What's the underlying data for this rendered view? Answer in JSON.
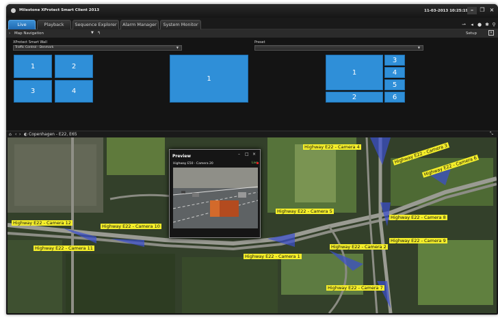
{
  "app": {
    "title": "Milestone XProtect Smart Client 2013",
    "datetime": "11-03-2013 10:25:19"
  },
  "tabs": [
    {
      "label": "Live"
    },
    {
      "label": "Playback"
    },
    {
      "label": "Sequence Explorer"
    },
    {
      "label": "Alarm Manager"
    },
    {
      "label": "System Monitor"
    }
  ],
  "nav": {
    "map_navigation": "Map Navigation",
    "setup": "Setup"
  },
  "smartwall": {
    "label": "XProtect Smart Wall",
    "selected": "Traffic Control - Denmark",
    "preset_label": "Preset",
    "preset_value": ""
  },
  "monitors": {
    "m1": [
      "1",
      "2",
      "3",
      "4"
    ],
    "m2": [
      "1"
    ],
    "m3": [
      "3",
      "1",
      "4",
      "5",
      "2",
      "6"
    ]
  },
  "map": {
    "breadcrumb": "Copenhagen - E22, E65",
    "cameras": [
      {
        "label": "Highway E22 - Camera 4"
      },
      {
        "label": "Highway E22 - Camera 3"
      },
      {
        "label": "Highway E22 - Camera 6"
      },
      {
        "label": "Highway E22 - Camera 5"
      },
      {
        "label": "Highway E22 - Camera 8"
      },
      {
        "label": "Highway E22 - Camera 12"
      },
      {
        "label": "Highway E22 - Camera 10"
      },
      {
        "label": "Highway E22 - Camera 9"
      },
      {
        "label": "Highway E22 - Camera 11"
      },
      {
        "label": "Highway E22 - Camera 2"
      },
      {
        "label": "Highway E22 - Camera 1"
      },
      {
        "label": "Highway E22 - Camera 7"
      }
    ]
  },
  "preview": {
    "title": "Preview",
    "camera": "Highway E50 - Camera 20",
    "status": "Live"
  },
  "colors": {
    "accent": "#2f8fd8",
    "camera_label": "#f4ee2a",
    "window_bg": "#141414"
  }
}
